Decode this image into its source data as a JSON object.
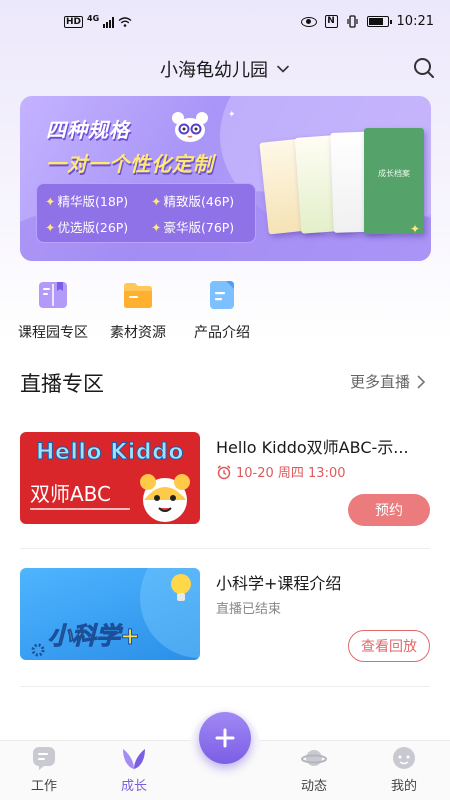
{
  "status_bar": {
    "network": "HD",
    "signal_type": "4G",
    "time": "10:21"
  },
  "header": {
    "title": "小海龟幼儿园"
  },
  "banner": {
    "headline_1": "四种规格",
    "headline_2": "一对一个性化定制",
    "options": [
      "精华版(18P)",
      "精致版(46P)",
      "优选版(26P)",
      "豪华版(76P)"
    ],
    "book_labels": [
      "成长档案"
    ]
  },
  "quick_entries": [
    {
      "label": "课程园专区",
      "icon": "book-icon"
    },
    {
      "label": "素材资源",
      "icon": "folder-icon"
    },
    {
      "label": "产品介绍",
      "icon": "document-icon"
    }
  ],
  "live_section": {
    "title": "直播专区",
    "more_label": "更多直播",
    "items": [
      {
        "title": "Hello Kiddo双师ABC-示...",
        "thumb_line1": "Hello Kiddo",
        "thumb_line2": "双师ABC",
        "time": "10-20 周四 13:00",
        "button": "预约"
      },
      {
        "title": "小科学+课程介绍",
        "thumb_text": "小科学+",
        "status": "直播已结束",
        "button": "查看回放"
      }
    ]
  },
  "tab_bar": {
    "tabs": [
      {
        "label": "工作",
        "icon": "chat-icon"
      },
      {
        "label": "成长",
        "icon": "sprout-icon",
        "active": true
      },
      {
        "label": "动态",
        "icon": "planet-icon"
      },
      {
        "label": "我的",
        "icon": "face-icon"
      }
    ],
    "fab_icon": "plus-icon"
  },
  "colors": {
    "accent": "#7a5ee0",
    "primary_button": "#ec7b7d",
    "time_red": "#e05a5c"
  }
}
